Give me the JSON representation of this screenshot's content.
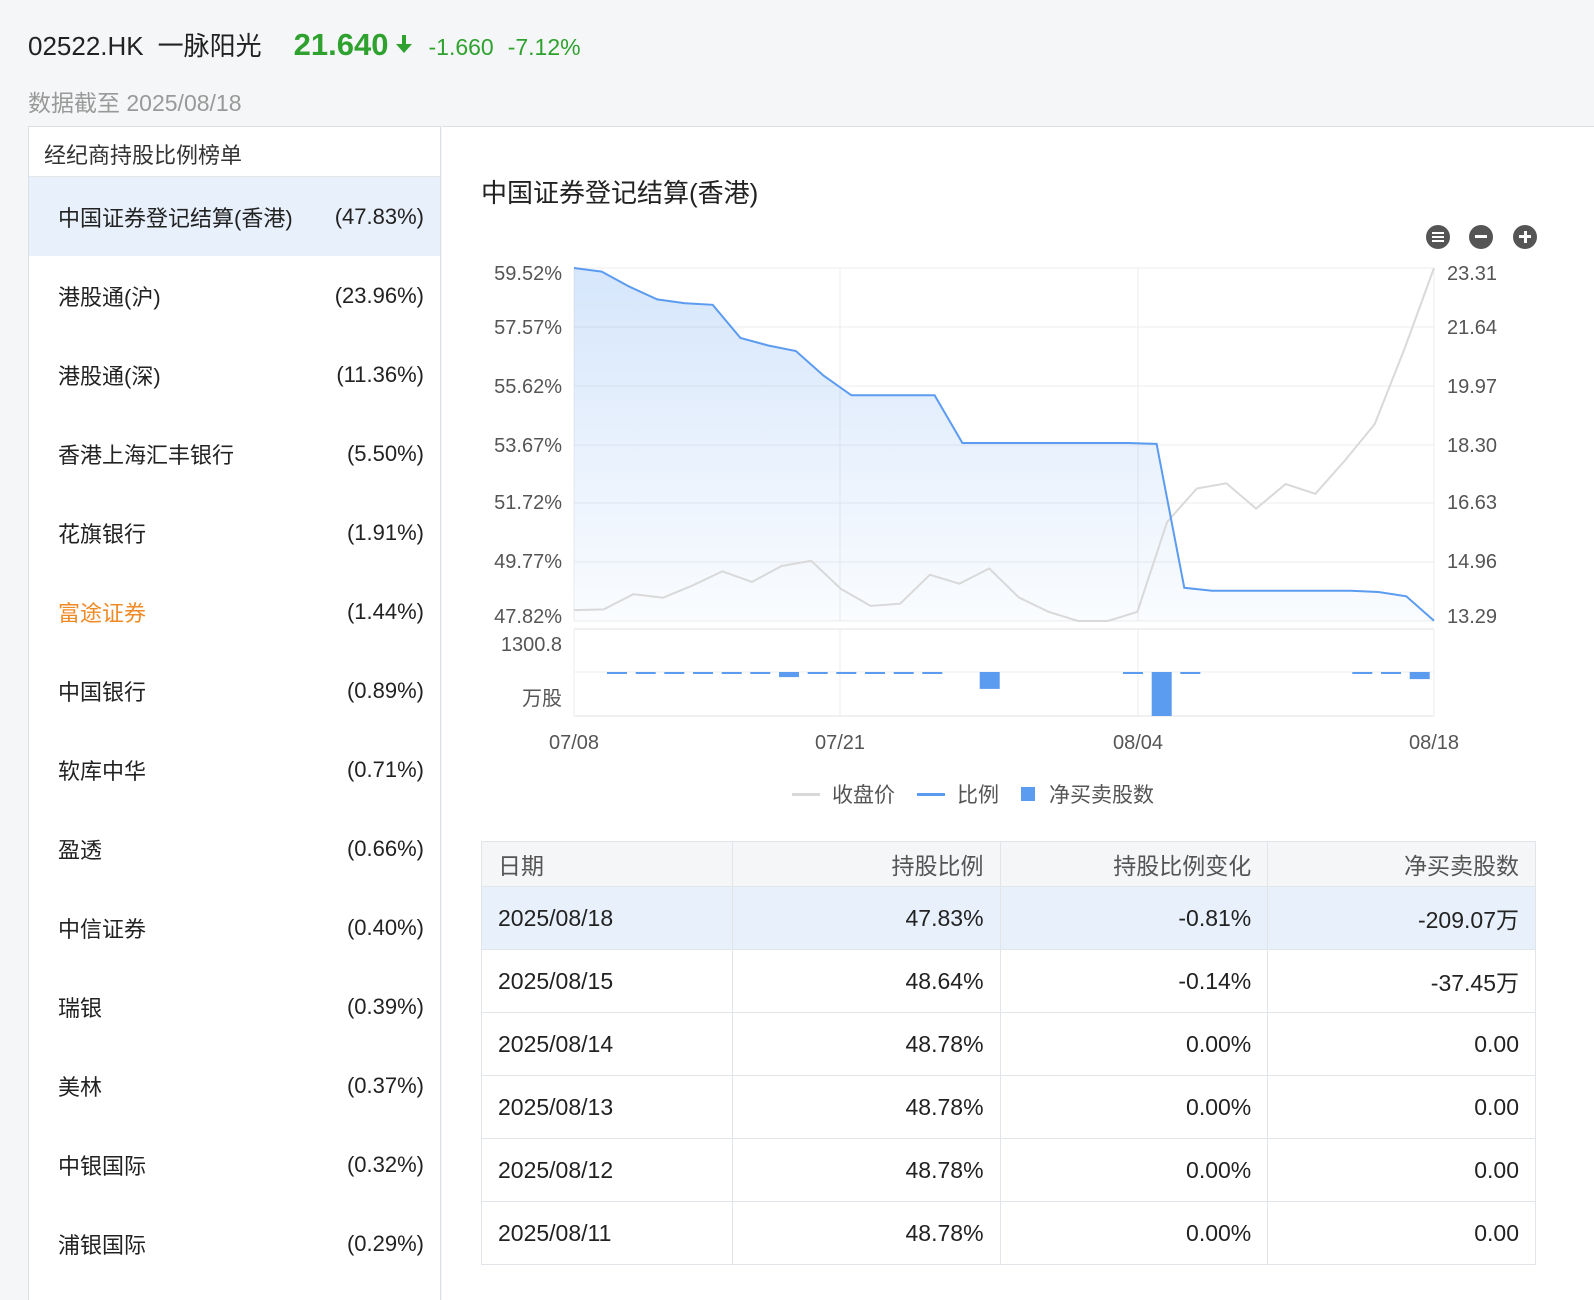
{
  "header": {
    "code": "02522.HK",
    "name": "一脉阳光",
    "price": "21.640",
    "change": "-1.660",
    "change_pct": "-7.12%",
    "as_of": "数据截至 2025/08/18",
    "down_color": "#2ea12e"
  },
  "left": {
    "title": "经纪商持股比例榜单",
    "brokers": [
      {
        "name": "中国证券登记结算(香港)",
        "pct": "(47.83%)"
      },
      {
        "name": "港股通(沪)",
        "pct": "(23.96%)"
      },
      {
        "name": "港股通(深)",
        "pct": "(11.36%)"
      },
      {
        "name": "香港上海汇丰银行",
        "pct": "(5.50%)"
      },
      {
        "name": "花旗银行",
        "pct": "(1.91%)"
      },
      {
        "name": "富途证券",
        "pct": "(1.44%)"
      },
      {
        "name": "中国银行",
        "pct": "(0.89%)"
      },
      {
        "name": "软库中华",
        "pct": "(0.71%)"
      },
      {
        "name": "盈透",
        "pct": "(0.66%)"
      },
      {
        "name": "中信证券",
        "pct": "(0.40%)"
      },
      {
        "name": "瑞银",
        "pct": "(0.39%)"
      },
      {
        "name": "美林",
        "pct": "(0.37%)"
      },
      {
        "name": "中银国际",
        "pct": "(0.32%)"
      },
      {
        "name": "浦银国际",
        "pct": "(0.29%)"
      }
    ]
  },
  "chart_title": "中国证券登记结算(香港)",
  "chart_data": {
    "type": "line",
    "left_axis": {
      "ticks": [
        "59.52%",
        "57.57%",
        "55.62%",
        "53.67%",
        "51.72%",
        "49.77%",
        "47.82%"
      ],
      "min": 47.82,
      "max": 59.52
    },
    "right_axis": {
      "ticks": [
        "23.31",
        "21.64",
        "19.97",
        "18.30",
        "16.63",
        "14.96",
        "13.29"
      ],
      "min": 13.29,
      "max": 23.31
    },
    "volume_axis": {
      "top_label": "1300.8",
      "unit_label": "万股"
    },
    "x_ticks": [
      "07/08",
      "07/21",
      "08/04",
      "08/18"
    ],
    "series": [
      {
        "name": "收盘价",
        "color": "#d9d9d9",
        "values": [
          13.6,
          13.62,
          14.05,
          13.95,
          14.3,
          14.7,
          14.4,
          14.85,
          15.0,
          14.2,
          13.72,
          13.78,
          14.6,
          14.35,
          14.78,
          13.96,
          13.55,
          13.29,
          13.29,
          13.55,
          16.1,
          17.05,
          17.2,
          16.48,
          17.18,
          16.9,
          17.85,
          18.88,
          21.0,
          23.31
        ]
      },
      {
        "name": "比例",
        "color": "#5b9bf0",
        "values": [
          59.52,
          59.4,
          58.9,
          58.48,
          58.35,
          58.3,
          57.2,
          56.95,
          56.77,
          55.95,
          55.3,
          55.3,
          55.3,
          55.3,
          53.72,
          53.72,
          53.72,
          53.72,
          53.72,
          53.72,
          53.72,
          53.69,
          48.92,
          48.82,
          48.82,
          48.82,
          48.82,
          48.82,
          48.82,
          48.78,
          48.64,
          47.83
        ]
      },
      {
        "name": "净买卖股数",
        "color": "#5b9bf0",
        "values": [
          0,
          -5,
          -20,
          -20,
          -12,
          -10,
          -12,
          -150,
          -12,
          -12,
          -40,
          -30,
          -15,
          0,
          -500,
          0,
          0,
          0,
          0,
          -20,
          -1300.8,
          -30,
          0,
          0,
          0,
          0,
          0,
          -15,
          -37.45,
          -209.07
        ]
      }
    ]
  },
  "legend": {
    "close": "收盘价",
    "ratio": "比例",
    "net": "净买卖股数"
  },
  "table": {
    "headers": [
      "日期",
      "持股比例",
      "持股比例变化",
      "净买卖股数"
    ],
    "rows": [
      [
        "2025/08/18",
        "47.83%",
        "-0.81%",
        "-209.07万"
      ],
      [
        "2025/08/15",
        "48.64%",
        "-0.14%",
        "-37.45万"
      ],
      [
        "2025/08/14",
        "48.78%",
        "0.00%",
        "0.00"
      ],
      [
        "2025/08/13",
        "48.78%",
        "0.00%",
        "0.00"
      ],
      [
        "2025/08/12",
        "48.78%",
        "0.00%",
        "0.00"
      ],
      [
        "2025/08/11",
        "48.78%",
        "0.00%",
        "0.00"
      ]
    ]
  }
}
